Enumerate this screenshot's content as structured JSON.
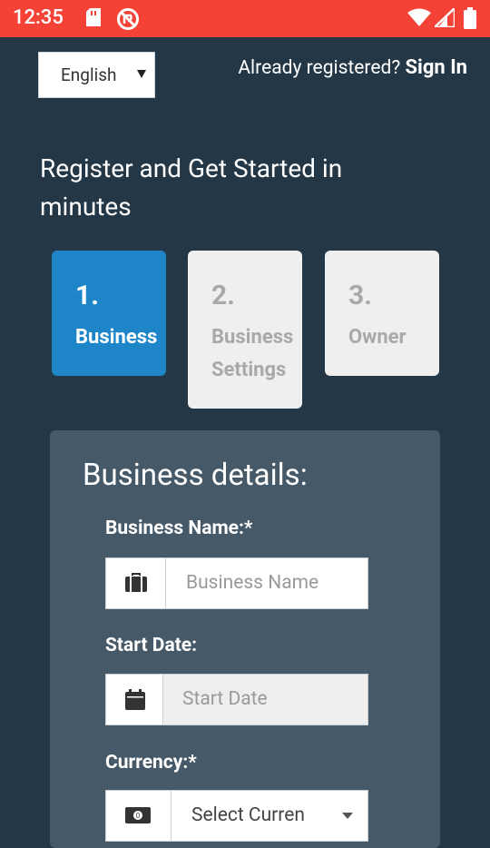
{
  "status_bar": {
    "time": "12:35",
    "icons": [
      "sd-card-icon",
      "blocked-icon",
      "wifi-icon",
      "signal-icon",
      "battery-icon"
    ],
    "color": "#f44336"
  },
  "header": {
    "language_value": "English",
    "already_text": "Already registered?",
    "sign_in_label": "Sign In"
  },
  "headline": "Register and Get Started in minutes",
  "steps": [
    {
      "num": "1.",
      "label": "Business",
      "active": true
    },
    {
      "num": "2.",
      "label_line1": "Business",
      "label_line2": "Settings",
      "active": false
    },
    {
      "num": "3.",
      "label": "Owner",
      "active": false
    }
  ],
  "form": {
    "title": "Business details:",
    "business_name": {
      "label": "Business Name:*",
      "placeholder": "Business Name"
    },
    "start_date": {
      "label": "Start Date:",
      "placeholder": "Start Date"
    },
    "currency": {
      "label": "Currency:*",
      "placeholder": "Select Curren"
    }
  },
  "colors": {
    "background": "#243746",
    "accent": "#1e86c8",
    "panel": "#465968"
  }
}
